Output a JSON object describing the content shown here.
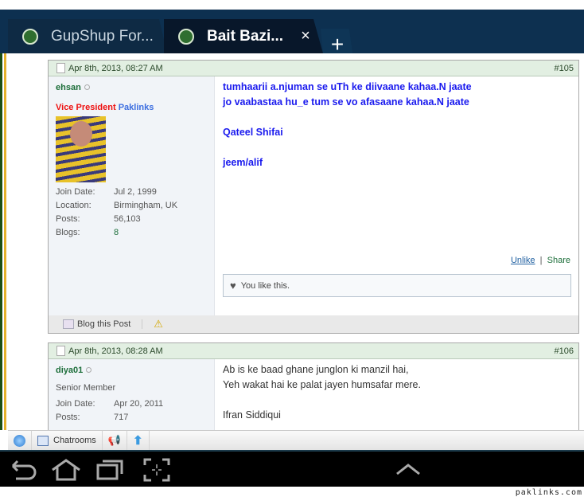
{
  "tabs": [
    {
      "title": "GupShup For..."
    },
    {
      "title": "Bait Bazi...",
      "close": "×"
    }
  ],
  "new_tab": "+",
  "posts": [
    {
      "date": "Apr 8th, 2013, 08:27 AM",
      "number": "#105",
      "username": "ehsan",
      "rank_part1": "Vice President",
      "rank_part2": "Paklinks",
      "info": [
        [
          "Join Date:",
          "Jul 2, 1999"
        ],
        [
          "Location:",
          "Birmingham, UK"
        ],
        [
          "Posts:",
          "56,103"
        ],
        [
          "Blogs:",
          "8"
        ]
      ],
      "lines": [
        "tumhaarii a.njuman se uTh ke diivaane kahaa.N jaate",
        "jo vaabastaa hu_e tum se vo afasaane kahaa.N jaate",
        "",
        "Qateel Shifai",
        "",
        "jeem/alif"
      ],
      "unlike": "Unlike",
      "share": "Share",
      "like_text": "You like this.",
      "blog_post": "Blog this Post"
    },
    {
      "date": "Apr 8th, 2013, 08:28 AM",
      "number": "#106",
      "username": "diya01",
      "rank": "Senior Member",
      "info": [
        [
          "Join Date:",
          "Apr 20, 2011"
        ],
        [
          "Posts:",
          "717"
        ]
      ],
      "lines": [
        "Ab is ke baad ghane junglon ki manzil hai,",
        "Yeh wakat hai ke palat jayen humsafar mere.",
        "",
        "Ifran Siddiqui"
      ]
    }
  ],
  "toolbar": {
    "chatrooms": "Chatrooms"
  },
  "credit": "paklinks.com",
  "colors": {
    "tabbar": "#0d3050",
    "link_blue": "#0000ee",
    "green": "#1d6e3a",
    "rank_red": "#ee1111"
  }
}
